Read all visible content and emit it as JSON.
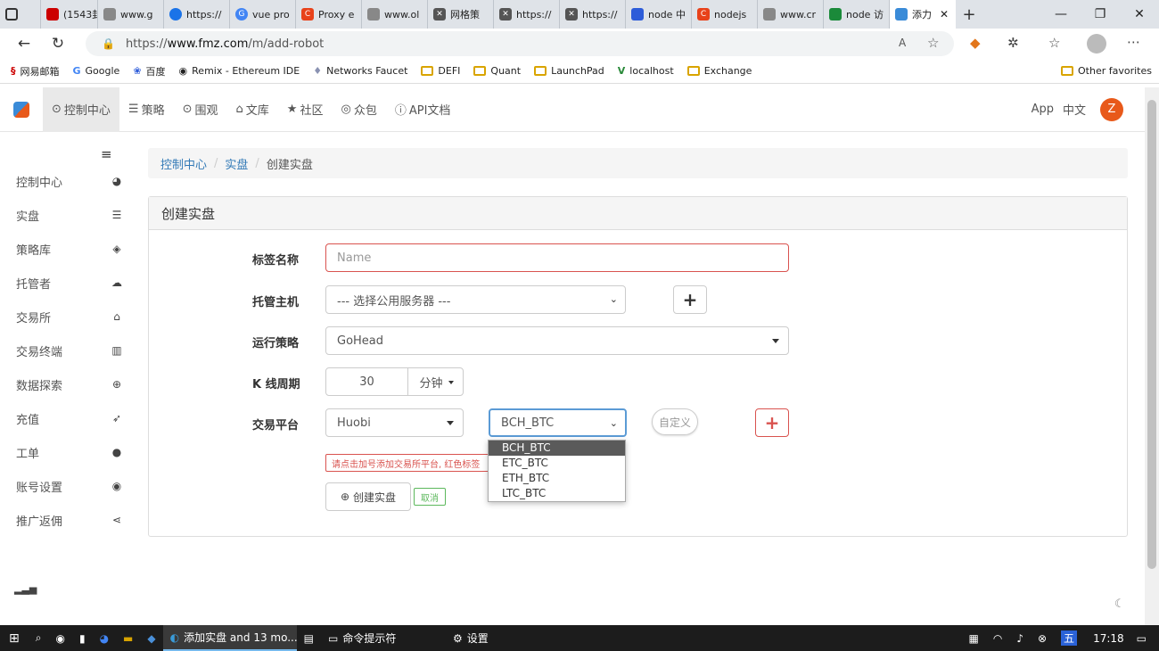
{
  "browser": {
    "tabs": [
      "(1543封",
      "www.g",
      "https://",
      "vue pro",
      "Proxy e",
      "www.ol",
      "网格策",
      "https://",
      "https://",
      "node 中",
      "nodejs",
      "www.cr",
      "node 访",
      "添力"
    ],
    "url_prefix": "https://",
    "url_host": "www.fmz.com",
    "url_path": "/m/add-robot",
    "favorites": [
      "网易邮箱",
      "Google",
      "百度",
      "Remix - Ethereum IDE",
      "Networks Faucet",
      "DEFI",
      "Quant",
      "LaunchPad",
      "localhost",
      "Exchange"
    ],
    "other_favorites": "Other favorites"
  },
  "nav": {
    "items": [
      "控制中心",
      "策略",
      "围观",
      "文库",
      "社区",
      "众包",
      "API文档"
    ],
    "app": "App",
    "lang": "中文",
    "avatar": "Z"
  },
  "sidebar": {
    "items": [
      "控制中心",
      "实盘",
      "策略库",
      "托管者",
      "交易所",
      "交易终端",
      "数据探索",
      "充值",
      "工单",
      "账号设置",
      "推广返佣"
    ],
    "icons": [
      "dashboard-icon",
      "list-icon",
      "cube-icon",
      "cloud-icon",
      "bank-icon",
      "bar-chart-icon",
      "search-plus-icon",
      "rocket-icon",
      "comment-icon",
      "user-circle-icon",
      "share-icon"
    ]
  },
  "breadcrumb": {
    "home": "控制中心",
    "section": "实盘",
    "current": "创建实盘"
  },
  "form": {
    "title": "创建实盘",
    "label_name": "标签名称",
    "name_placeholder": "Name",
    "label_host": "托管主机",
    "host_value": "--- 选择公用服务器 ---",
    "label_strategy": "运行策略",
    "strategy_value": "GoHead",
    "label_kline": "K 线周期",
    "kline_value": "30",
    "kline_unit": "分钟",
    "label_exchange": "交易平台",
    "exchange_value": "Huobi",
    "pair_value": "BCH_BTC",
    "custom_label": "自定义",
    "pair_options": [
      "BCH_BTC",
      "ETC_BTC",
      "ETH_BTC",
      "LTC_BTC"
    ],
    "warning": "请点击加号添加交易所平台, 红色标签",
    "create_button": "创建实盘",
    "cancel_button": "取消"
  },
  "taskbar": {
    "edge_title": "添加实盘 and 13 mo...",
    "cmd_title": "命令提示符",
    "settings_title": "设置",
    "ime": "五",
    "time": "17:18"
  },
  "colors": {
    "accent": "#337ab7",
    "danger": "#d9534f",
    "avatar": "#e8591a",
    "success": "#5cb85c"
  }
}
